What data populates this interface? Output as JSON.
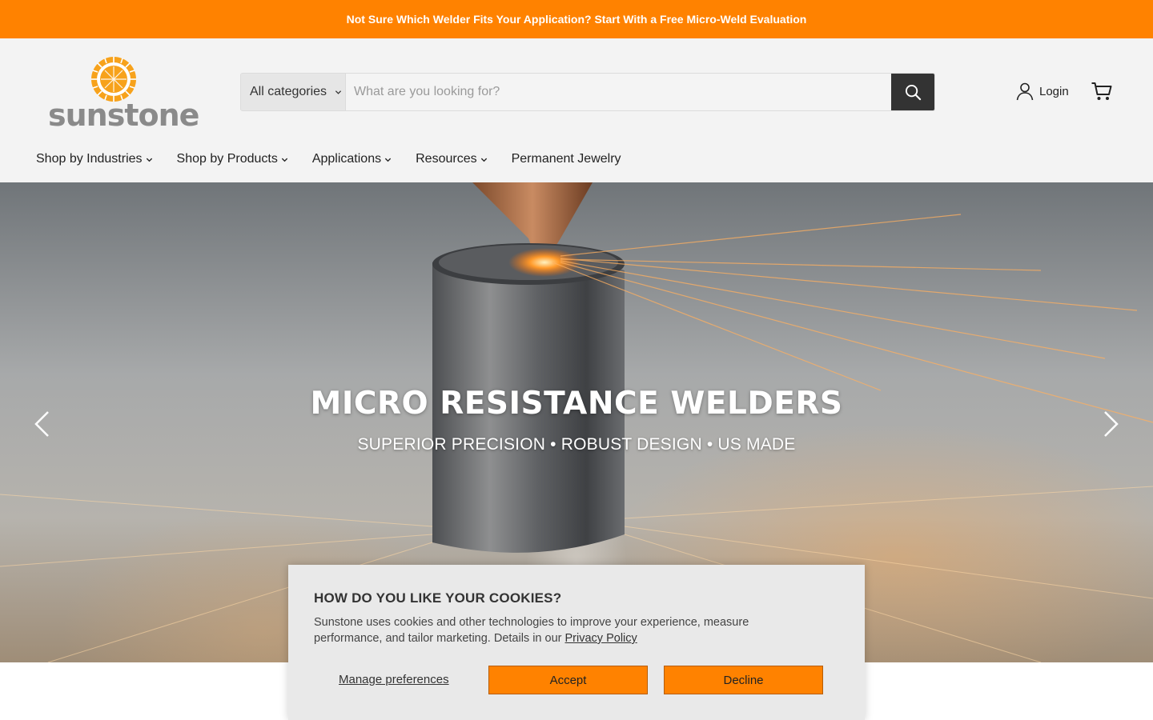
{
  "promo": {
    "text": "Not Sure Which Welder Fits Your Application? Start With a Free Micro-Weld Evaluation"
  },
  "header": {
    "logo_text": "sunstone",
    "search": {
      "category": "All categories",
      "placeholder": "What are you looking for?",
      "icon": "search-icon"
    },
    "login_label": "Login",
    "cart_icon": "cart-icon"
  },
  "nav": {
    "items": [
      {
        "label": "Shop by Industries",
        "has_dropdown": true
      },
      {
        "label": "Shop by Products",
        "has_dropdown": true
      },
      {
        "label": "Applications",
        "has_dropdown": true
      },
      {
        "label": "Resources",
        "has_dropdown": true
      },
      {
        "label": "Permanent Jewelry",
        "has_dropdown": false
      }
    ]
  },
  "hero": {
    "title": "MICRO RESISTANCE WELDERS",
    "subtitle": "SUPERIOR PRECISION • ROBUST DESIGN • US MADE",
    "prev_icon": "chevron-left-icon",
    "next_icon": "chevron-right-icon"
  },
  "cookie": {
    "title": "HOW DO YOU LIKE YOUR COOKIES?",
    "body": "Sunstone uses cookies and other technologies to improve your experience, measure performance, and tailor marketing. Details in our ",
    "privacy_link": "Privacy Policy",
    "manage": "Manage preferences",
    "accept": "Accept",
    "decline": "Decline"
  },
  "colors": {
    "brand_orange": "#ff8200",
    "dark_button": "#333333",
    "header_bg": "#f3f3f3"
  }
}
